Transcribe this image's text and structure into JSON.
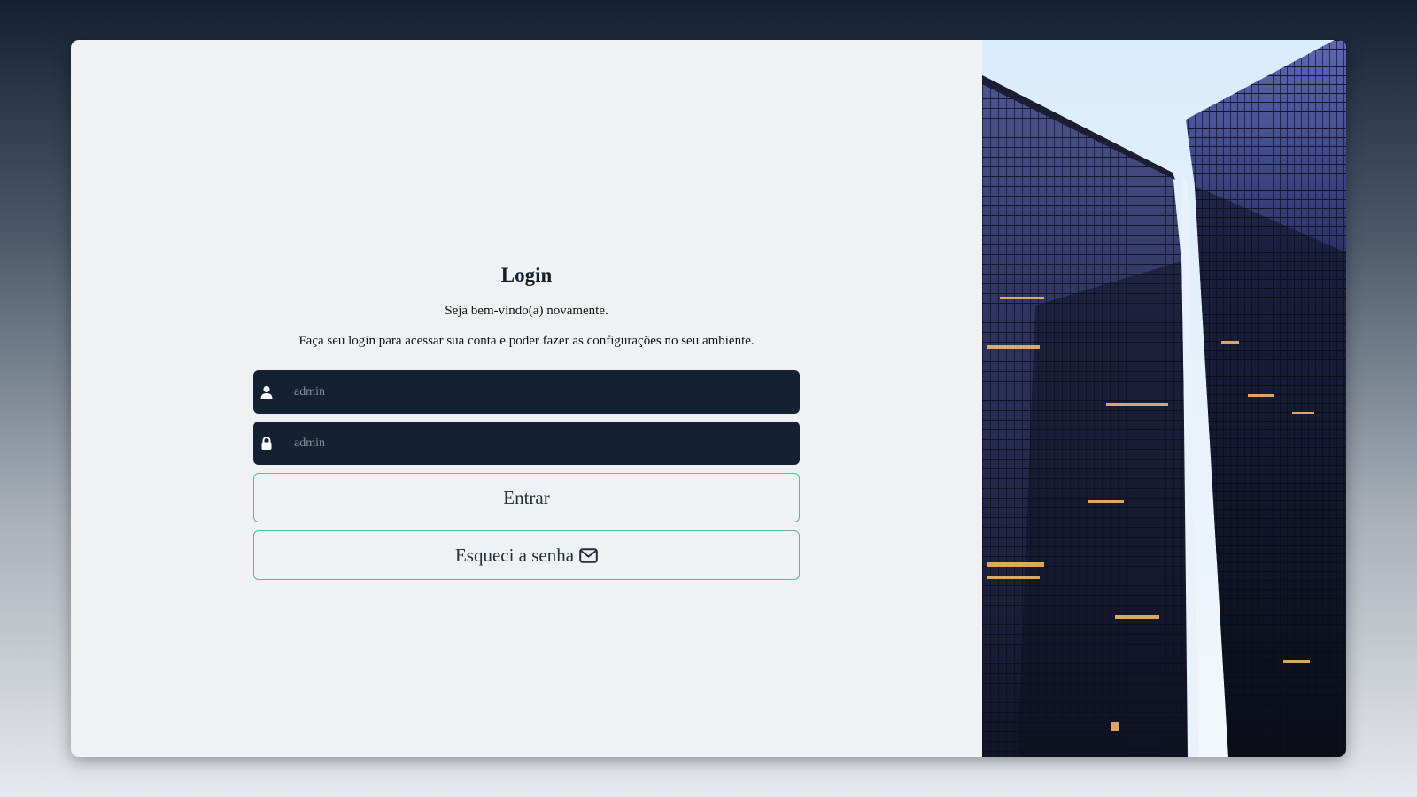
{
  "login": {
    "title": "Login",
    "welcome": "Seja bem-vindo(a) novamente.",
    "description": "Faça seu login para acessar sua conta e poder fazer as configurações no seu ambiente.",
    "username_placeholder": "admin",
    "password_placeholder": "admin",
    "submit_label": "Entrar",
    "forgot_label": "Esqueci a senha",
    "user_icon": "user-icon",
    "lock_icon": "lock-icon",
    "mail_icon": "envelope-icon"
  },
  "colors": {
    "field_bg": "#132133",
    "button_border": "#4ec08a",
    "card_bg": "#eff1f5",
    "title": "#131e2d"
  },
  "hero_image": {
    "icon": "buildings-photo"
  }
}
